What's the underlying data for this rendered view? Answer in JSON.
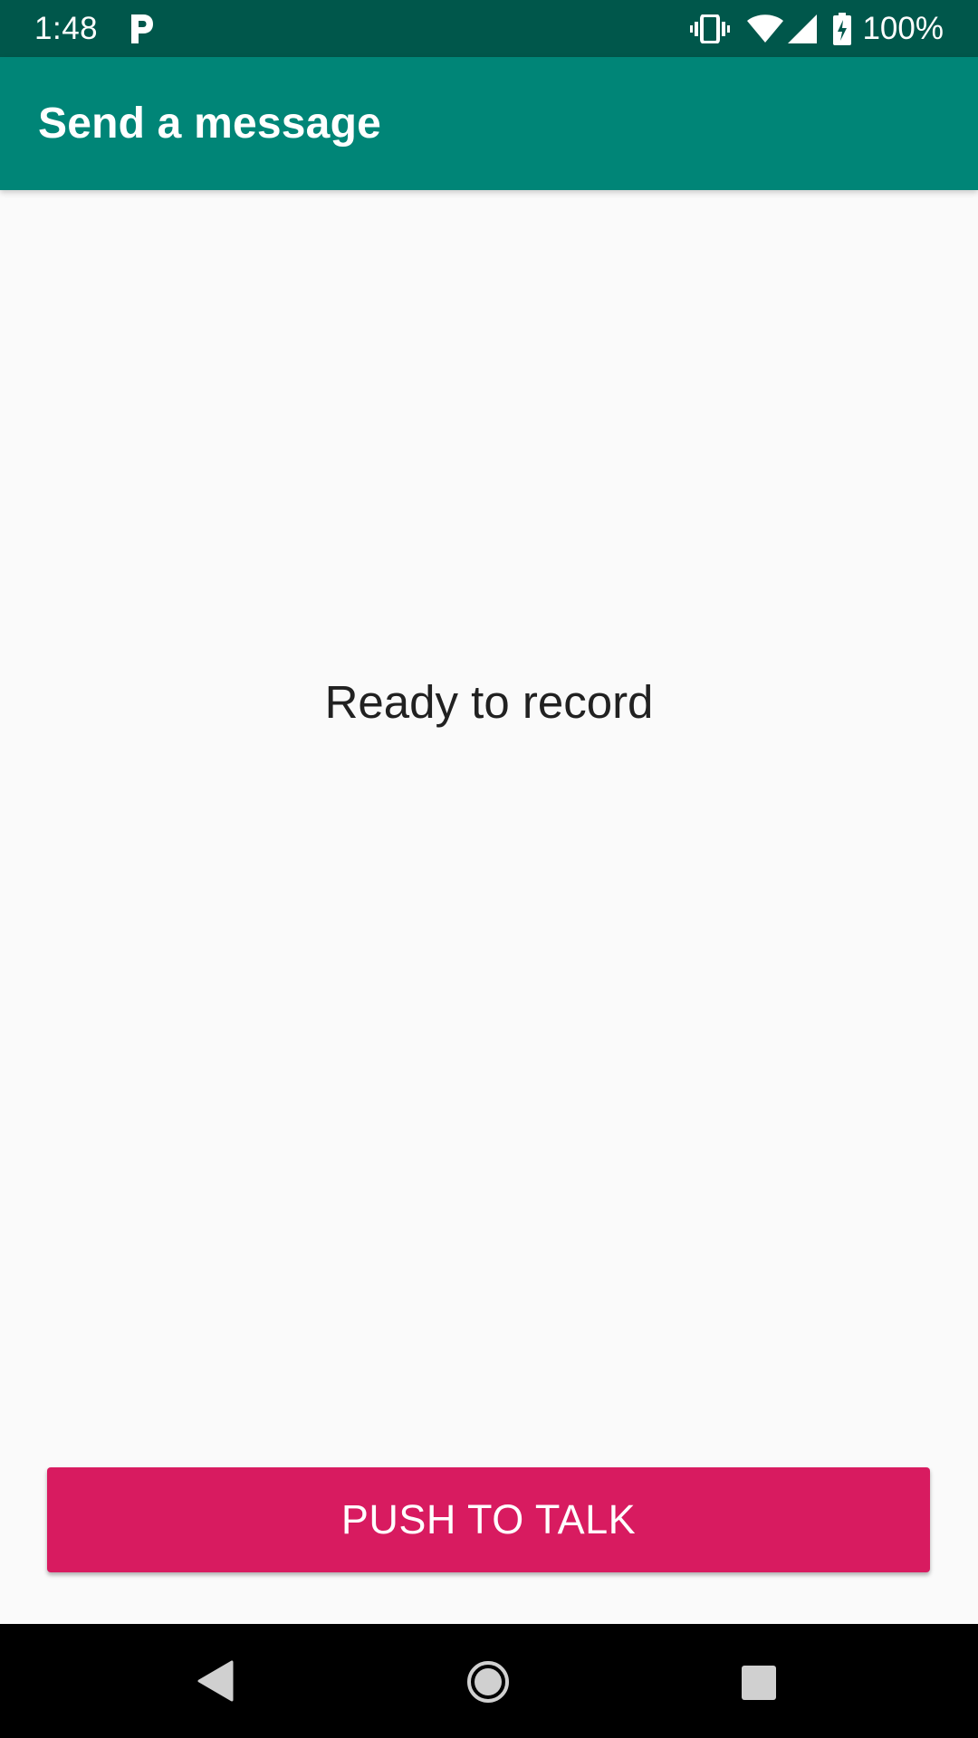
{
  "status_bar": {
    "time": "1:48",
    "battery_percent": "100%",
    "icons": [
      "parking-icon",
      "vibrate-icon",
      "wifi-icon",
      "cell-signal-icon",
      "battery-charging-icon"
    ]
  },
  "app_bar": {
    "title": "Send a message",
    "color": "#008577"
  },
  "main": {
    "status_text": "Ready to record",
    "push_button_label": "PUSH TO TALK",
    "accent_color": "#d81b60"
  },
  "nav_bar": {
    "icons": [
      "back-icon",
      "home-icon",
      "recents-icon"
    ]
  }
}
